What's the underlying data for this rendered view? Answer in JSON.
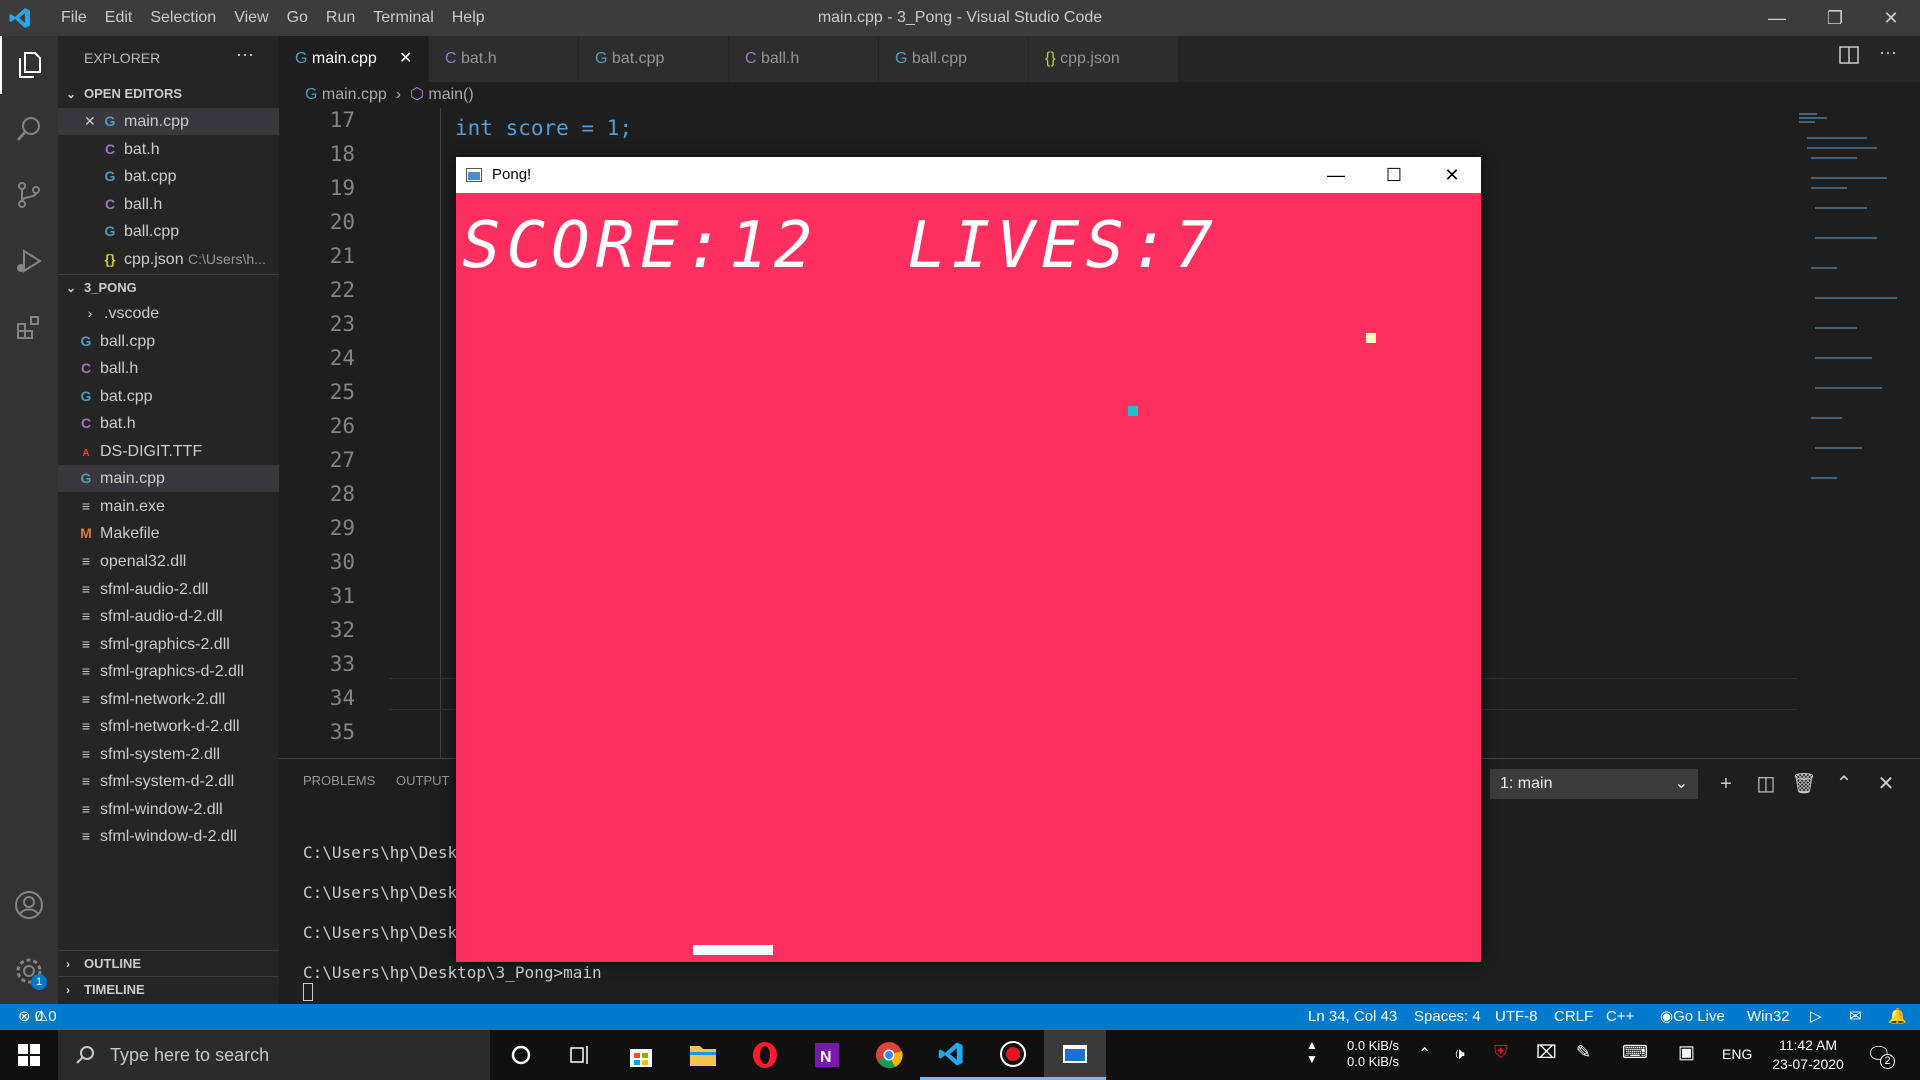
{
  "window": {
    "title": "main.cpp - 3_Pong - Visual Studio Code",
    "menu": [
      "File",
      "Edit",
      "Selection",
      "View",
      "Go",
      "Run",
      "Terminal",
      "Help"
    ]
  },
  "explorer": {
    "header": "EXPLORER",
    "more": "···",
    "open_editors_label": "OPEN EDITORS",
    "open_editors": [
      {
        "name": "main.cpp",
        "icon": "cpp-icon",
        "close": "✕"
      },
      {
        "name": "bat.h",
        "icon": "header-icon"
      },
      {
        "name": "bat.cpp",
        "icon": "cpp-icon"
      },
      {
        "name": "ball.h",
        "icon": "header-icon"
      },
      {
        "name": "ball.cpp",
        "icon": "cpp-icon"
      },
      {
        "name": "cpp.json",
        "icon": "json-icon",
        "path": "C:\\Users\\h..."
      }
    ],
    "folder_label": "3_PONG",
    "files": [
      {
        "name": ".vscode",
        "icon": "folder-icon"
      },
      {
        "name": "ball.cpp",
        "icon": "cpp-icon"
      },
      {
        "name": "ball.h",
        "icon": "header-icon"
      },
      {
        "name": "bat.cpp",
        "icon": "cpp-icon"
      },
      {
        "name": "bat.h",
        "icon": "header-icon"
      },
      {
        "name": "DS-DIGIT.TTF",
        "icon": "font-icon"
      },
      {
        "name": "main.cpp",
        "icon": "cpp-icon"
      },
      {
        "name": "main.exe",
        "icon": "file-icon"
      },
      {
        "name": "Makefile",
        "icon": "makefile-icon"
      },
      {
        "name": "openal32.dll",
        "icon": "file-icon"
      },
      {
        "name": "sfml-audio-2.dll",
        "icon": "file-icon"
      },
      {
        "name": "sfml-audio-d-2.dll",
        "icon": "file-icon"
      },
      {
        "name": "sfml-graphics-2.dll",
        "icon": "file-icon"
      },
      {
        "name": "sfml-graphics-d-2.dll",
        "icon": "file-icon"
      },
      {
        "name": "sfml-network-2.dll",
        "icon": "file-icon"
      },
      {
        "name": "sfml-network-d-2.dll",
        "icon": "file-icon"
      },
      {
        "name": "sfml-system-2.dll",
        "icon": "file-icon"
      },
      {
        "name": "sfml-system-d-2.dll",
        "icon": "file-icon"
      },
      {
        "name": "sfml-window-2.dll",
        "icon": "file-icon"
      },
      {
        "name": "sfml-window-d-2.dll",
        "icon": "file-icon"
      }
    ],
    "outline_label": "OUTLINE",
    "timeline_label": "TIMELINE",
    "settings_badge": "1"
  },
  "tabs": [
    {
      "label": "main.cpp",
      "icon": "cpp-icon",
      "active": true,
      "close": "✕"
    },
    {
      "label": "bat.h",
      "icon": "header-icon"
    },
    {
      "label": "bat.cpp",
      "icon": "cpp-icon"
    },
    {
      "label": "ball.h",
      "icon": "header-icon"
    },
    {
      "label": "ball.cpp",
      "icon": "cpp-icon"
    },
    {
      "label": "cpp.json",
      "icon": "json-icon"
    }
  ],
  "breadcrumb": {
    "file": "main.cpp",
    "symbol": "main()"
  },
  "editor": {
    "line_numbers": [
      "17",
      "18",
      "19",
      "20",
      "21",
      "22",
      "23",
      "24",
      "25",
      "26",
      "27",
      "28",
      "29",
      "30",
      "31",
      "32",
      "33",
      "34",
      "35"
    ],
    "visible_code": "int score = 1;"
  },
  "panel": {
    "tabs": [
      "PROBLEMS",
      "OUTPUT"
    ],
    "terminal_select": "1: main",
    "terminal_lines": [
      "C:\\Users\\hp\\Desk",
      "C:\\Users\\hp\\Desk",
      "C:\\Users\\hp\\Desk",
      "C:\\Users\\hp\\Desktop\\3_Pong>main"
    ]
  },
  "status": {
    "errors": "0",
    "warnings": "0",
    "position": "Ln 34, Col 43",
    "spaces": "Spaces: 4",
    "encoding": "UTF-8",
    "eol": "CRLF",
    "language": "C++",
    "golive": "Go Live",
    "platform": "Win32"
  },
  "pong": {
    "title": "Pong!",
    "hud": "SCORE:12  LIVES:7",
    "background_color": "#ff3060"
  },
  "taskbar": {
    "search_placeholder": "Type here to search",
    "net_up": "0.0 KiB/s",
    "net_down": "0.0 KiB/s",
    "lang": "ENG",
    "time": "11:42 AM",
    "date": "23-07-2020",
    "notifications": "2"
  },
  "colors": {
    "accent": "#007acc",
    "pong_bg": "#ff3060",
    "ball1": "#ffffc0",
    "ball2": "#20c0d0"
  }
}
